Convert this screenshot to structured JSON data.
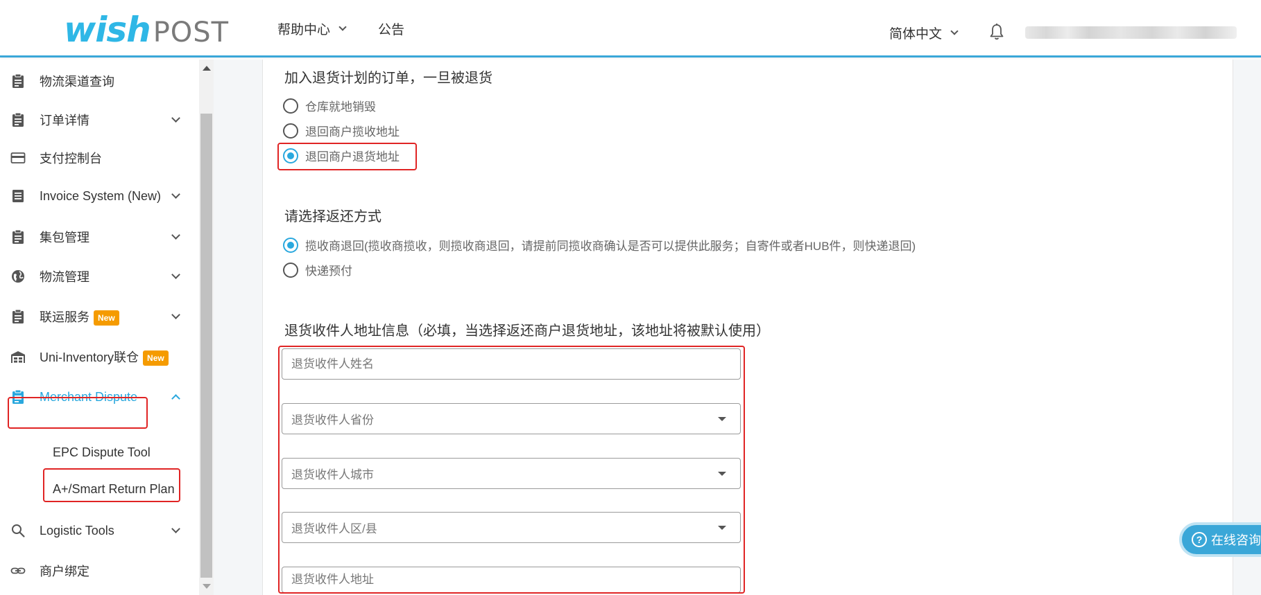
{
  "header": {
    "logo_wish": "wish",
    "logo_post": "POST",
    "nav_help": "帮助中心",
    "nav_notice": "公告",
    "language": "简体中文",
    "bell_icon": "bell-icon",
    "accent_color": "#3aa7d8"
  },
  "sidebar": {
    "items": [
      {
        "label": "物流渠道查询",
        "icon": "clipboard-icon"
      },
      {
        "label": "订单详情",
        "icon": "clipboard-icon"
      },
      {
        "label": "支付控制台",
        "icon": "credit-card-icon"
      },
      {
        "label": "Invoice System (New)",
        "icon": "document-icon"
      },
      {
        "label": "集包管理",
        "icon": "clipboard-icon"
      },
      {
        "label": "物流管理",
        "icon": "globe-icon"
      },
      {
        "label": "联运服务",
        "icon": "clipboard-icon",
        "badge": "New"
      },
      {
        "label": "Uni-Inventory联仓",
        "icon": "warehouse-icon",
        "badge": "New"
      },
      {
        "label": "Merchant Dispute",
        "icon": "clipboard-icon"
      },
      {
        "label": "Logistic Tools",
        "icon": "search-icon"
      },
      {
        "label": "商户绑定",
        "icon": "link-icon"
      }
    ],
    "sub_items": [
      "EPC Dispute Tool",
      "A+/Smart Return Plan"
    ]
  },
  "main": {
    "section1_title": "加入退货计划的订单，一旦被退货",
    "section1_options": [
      "仓库就地销毁",
      "退回商户揽收地址",
      "退回商户退货地址"
    ],
    "section1_selected": "退回商户退货地址",
    "section2_title": "请选择返还方式",
    "section2_options": [
      "揽收商退回(揽收商揽收，则揽收商退回，请提前同揽收商确认是否可以提供此服务；自寄件或者HUB件，则快递退回)",
      "快递预付"
    ],
    "section2_selected": "揽收商退回(揽收商揽收，则揽收商退回，请提前同揽收商确认是否可以提供此服务；自寄件或者HUB件，则快递退回)",
    "section3_title": "退货收件人地址信息（必填，当选择返还商户退货地址，该地址将被默认使用）",
    "fields": {
      "name_placeholder": "退货收件人姓名",
      "province_placeholder": "退货收件人省份",
      "city_placeholder": "退货收件人城市",
      "district_placeholder": "退货收件人区/县",
      "address_placeholder": "退货收件人地址"
    }
  },
  "chat": {
    "label": "在线咨询",
    "icon": "question-icon"
  }
}
